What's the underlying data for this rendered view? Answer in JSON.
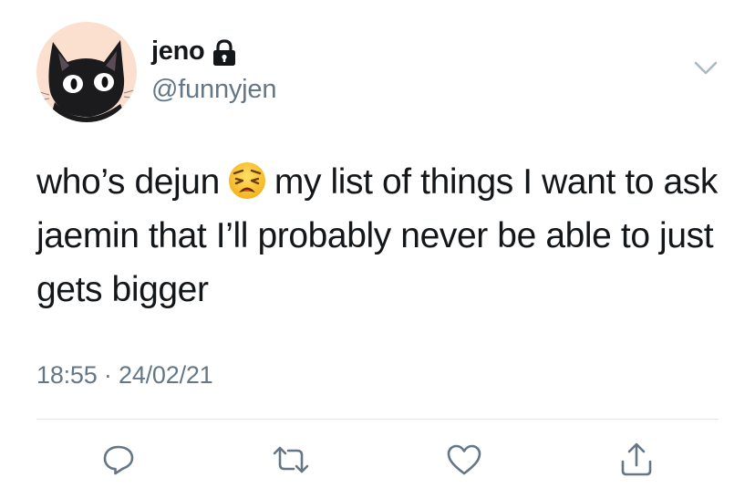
{
  "user": {
    "display_name": "jeno",
    "handle": "@funnyjen",
    "avatar": "black-cat-avatar",
    "locked_icon": "lock-icon"
  },
  "tweet": {
    "text_before_emoji": "who’s dejun",
    "emoji": "weary-face-emoji",
    "text_after_emoji": "my list of things I want to ask jaemin that I’ll probably never be able to just gets bigger",
    "time": "18:55",
    "separator": "·",
    "date": "24/02/21"
  },
  "actions": [
    {
      "name": "reply",
      "icon": "reply-icon"
    },
    {
      "name": "retweet",
      "icon": "retweet-icon"
    },
    {
      "name": "like",
      "icon": "heart-icon"
    },
    {
      "name": "share",
      "icon": "share-icon"
    }
  ],
  "colors": {
    "text": "#14171a",
    "secondary": "#657786",
    "divider": "#e1e8ed",
    "avatar_bg": "#fbe0d0"
  }
}
